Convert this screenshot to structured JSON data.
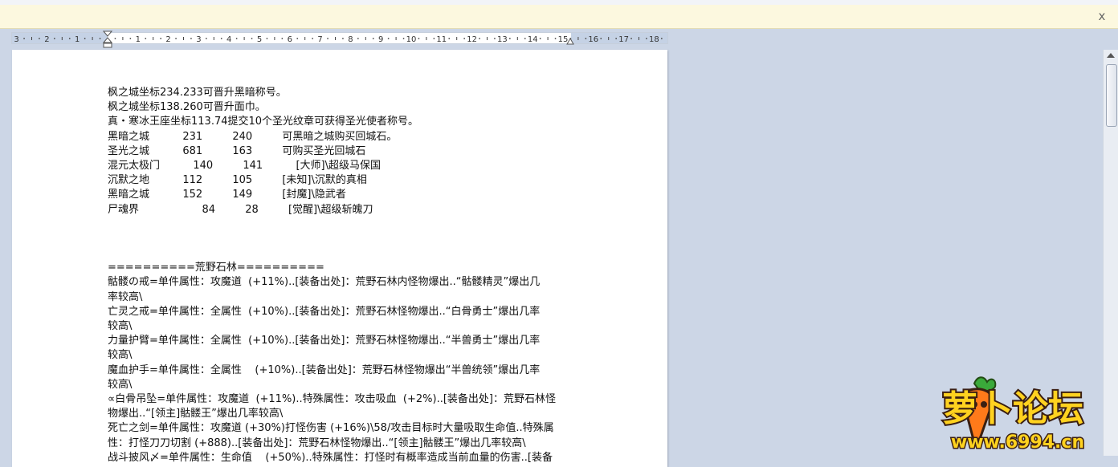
{
  "message_bar": {
    "close_label": "x"
  },
  "ruler": {
    "labels": [
      "3",
      "2",
      "1",
      "1",
      "2",
      "3",
      "4",
      "5",
      "6",
      "7",
      "8",
      "9",
      "10",
      "11",
      "12",
      "13",
      "14",
      "15",
      "16",
      "17",
      "18"
    ]
  },
  "document": {
    "lines": [
      "枫之城坐标234.233可晋升黑暗称号。",
      "枫之城坐标138.260可晋升面巾。",
      "真・寒冰王座坐标113.74提交10个圣光纹章可获得圣光使者称号。",
      "黑暗之城          231         240         可黑暗之城购买回城石。",
      "圣光之城          681         163         可购买圣光回城石",
      "混元太极门          140         141          [大师]\\超级马保国",
      "沉默之地          112         105         [未知]\\沉默的真相",
      "黑暗之城          152         149         [封魔]\\隐武者",
      "尸魂界                   84         28         [觉醒]\\超级斩魄刀",
      "",
      "",
      "",
      "==========荒野石林==========",
      "骷髅の戒=单件属性：攻魔道  (+11%)..[装备出处]：荒野石林内怪物爆出..“骷髅精灵”爆出几",
      "率较高\\",
      "亡灵之戒=单件属性：全属性  (+10%)..[装备出处]：荒野石林怪物爆出..“白骨勇士”爆出几率",
      "较高\\",
      "力量护臂=单件属性：全属性  (+10%)..[装备出处]：荒野石林怪物爆出..“半兽勇士”爆出几率",
      "较高\\",
      "魔血护手=单件属性：全属性    (+10%)..[装备出处]：荒野石林怪物爆出“半兽统领”爆出几率",
      "较高\\",
      "∝白骨吊坠=单件属性：攻魔道  (+11%)..特殊属性：攻击吸血  (+2%)..[装备出处]：荒野石林怪",
      "物爆出..“[领主]骷髅王”爆出几率较高\\",
      "死亡之剑=单件属性：攻魔道 (+30%)打怪伤害 (+16%)\\58/攻击目标时大量吸取生命值..特殊属",
      "性：打怪刀刀切割 (+888)..[装备出处]：荒野石林怪物爆出..“[领主]骷髅王”爆出几率较高\\",
      "战斗披风〆=单件属性：生命值    (+50%)..特殊属性：打怪时有概率造成当前血量的伤害..[装备"
    ]
  },
  "watermark": {
    "brand_text": "萝卜论坛",
    "url_text": "www.6994.cn"
  },
  "colors": {
    "workspace": "#ccd6e6",
    "message_bar": "#fcf8df",
    "watermark_yellow": "#ffd21f",
    "watermark_outline": "#3a1f12"
  }
}
